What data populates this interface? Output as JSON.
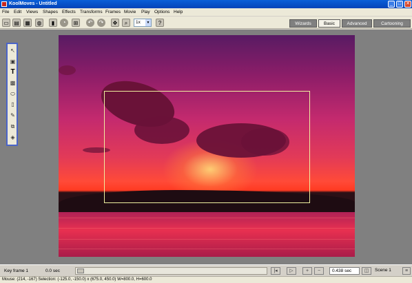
{
  "window": {
    "title": "KoolMoves - Untitled"
  },
  "menu": [
    "File",
    "Edit",
    "Views",
    "Shapes",
    "Effects",
    "Transforms",
    "Frames",
    "Movie",
    "Play",
    "Options",
    "Help"
  ],
  "toolbar": {
    "zoom_value": "1x"
  },
  "mode_tabs": [
    "Wizards",
    "Basic",
    "Advanced",
    "Cartooning"
  ],
  "active_tab": "Basic",
  "canvas": {
    "selection_color": "#f0f0a0"
  },
  "timeline": {
    "keyframe_label": "Key frame 1",
    "time_label": "0.0 sec",
    "duration_value": "0.438 sec",
    "scene_label": "Scene 1"
  },
  "status": {
    "text": "Mouse: (214, -167)  Selection: (-125.0, -150.0) x (675.0, 450.0)  W=800.0,  H=600.0"
  },
  "colors": {
    "titlebar": "#0a5fd8",
    "toolbox_border": "#4a64c8",
    "workspace": "#808080"
  }
}
